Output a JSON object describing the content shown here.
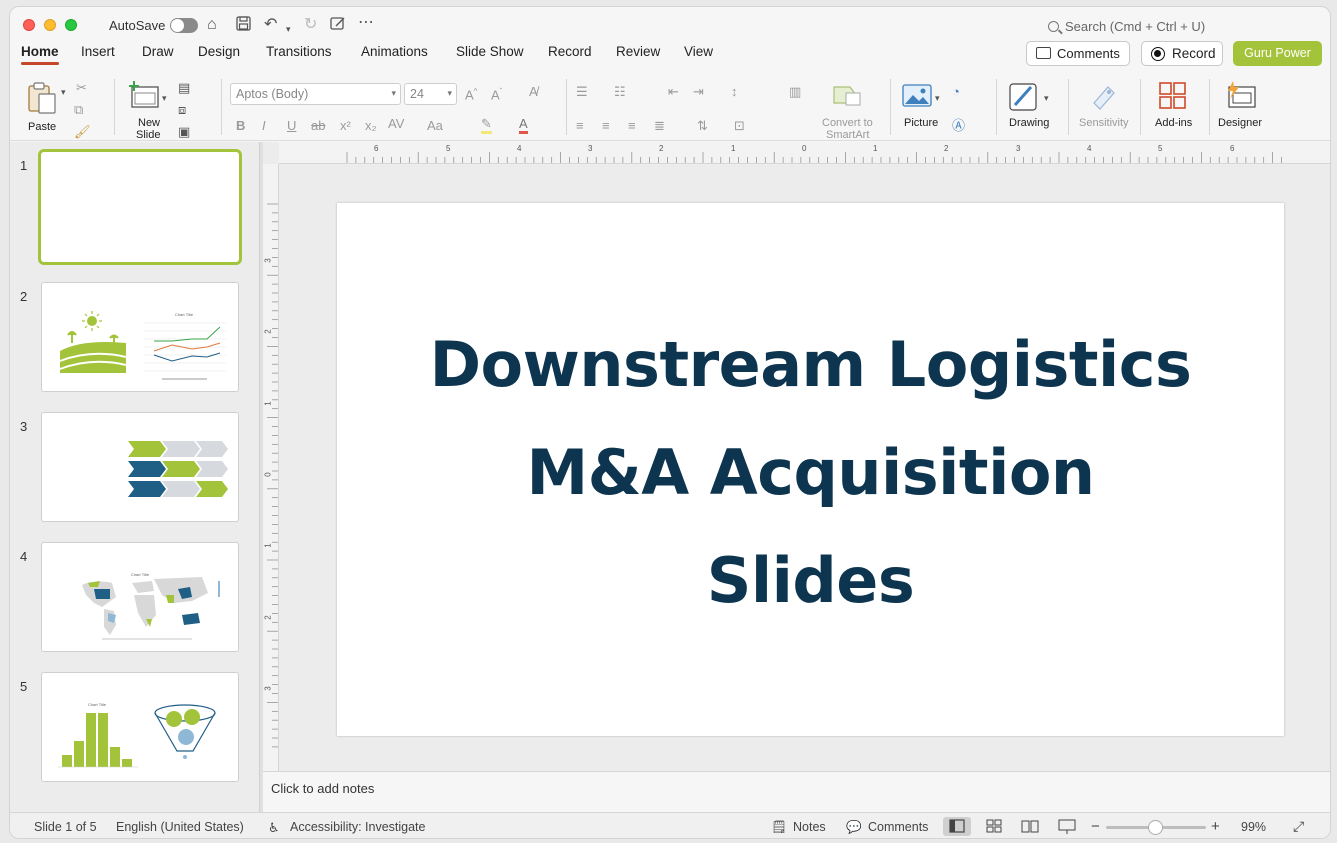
{
  "titlebar": {
    "autosave_label": "AutoSave",
    "autosave_on": false,
    "search_placeholder": "Search (Cmd + Ctrl + U)"
  },
  "tabs": [
    {
      "label": "Home",
      "active": true
    },
    {
      "label": "Insert"
    },
    {
      "label": "Draw"
    },
    {
      "label": "Design"
    },
    {
      "label": "Transitions"
    },
    {
      "label": "Animations"
    },
    {
      "label": "Slide Show"
    },
    {
      "label": "Record"
    },
    {
      "label": "Review"
    },
    {
      "label": "View"
    }
  ],
  "header_buttons": {
    "comments": "Comments",
    "record": "Record",
    "guru": "Guru Power"
  },
  "ribbon": {
    "paste": "Paste",
    "new_slide_1": "New",
    "new_slide_2": "Slide",
    "font_name": "Aptos (Body)",
    "font_size": "24",
    "convert_1": "Convert to",
    "convert_2": "SmartArt",
    "picture": "Picture",
    "drawing": "Drawing",
    "sensitivity": "Sensitivity",
    "addins": "Add-ins",
    "designer": "Designer"
  },
  "thumbnails": {
    "numbers": [
      "1",
      "2",
      "3",
      "4",
      "5"
    ],
    "selected_index": 1,
    "chart_title_text": "Chart Title"
  },
  "ruler": {
    "h_labels": [
      "6",
      "5",
      "4",
      "3",
      "2",
      "1",
      "0",
      "1",
      "2",
      "3",
      "4",
      "5",
      "6"
    ],
    "v_labels": [
      "3",
      "2",
      "1",
      "0",
      "1",
      "2",
      "3"
    ]
  },
  "slide": {
    "title_lines": [
      "Downstream Logistics",
      "M&A Acquisition",
      "Slides"
    ],
    "title_color": "#0d3550"
  },
  "notes": {
    "placeholder": "Click to add notes"
  },
  "status": {
    "slide_indicator": "Slide 1 of 5",
    "language": "English (United States)",
    "accessibility": "Accessibility: Investigate",
    "notes": "Notes",
    "comments": "Comments",
    "zoom": "99%"
  },
  "colors": {
    "accent_green": "#a3c43a",
    "navy": "#0d3550",
    "teal": "#1f5f86",
    "tab_underline": "#c4472b"
  }
}
